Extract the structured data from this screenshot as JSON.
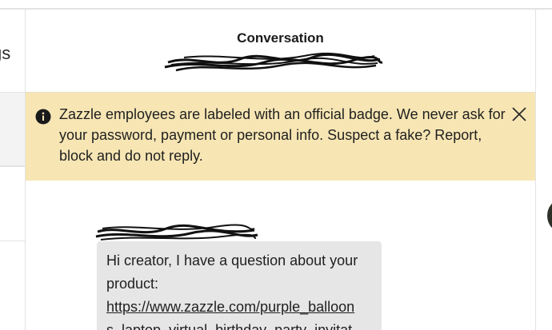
{
  "left_panel": {
    "settings_fragment": "gs"
  },
  "conversation": {
    "title": "Conversation",
    "recipient_name_redacted": true
  },
  "notice": {
    "text": "Zazzle employees are labeled with an official badge. We never ask for your password, payment or personal info. Suspect a fake? Report, block and do not reply.",
    "icon": "info-icon",
    "close_icon": "close-icon"
  },
  "message": {
    "sender_redacted": true,
    "line1": "Hi creator, I have a question about your",
    "line2": "product:",
    "link": "https://www.zazzle.com/purple_balloon",
    "link_cont": "s_laptop_virtual_birthday_party_invitat"
  },
  "colors": {
    "notice_bg": "#f7e6b4",
    "bubble_bg": "#e6e6e6",
    "divider": "#e3e3e3"
  }
}
